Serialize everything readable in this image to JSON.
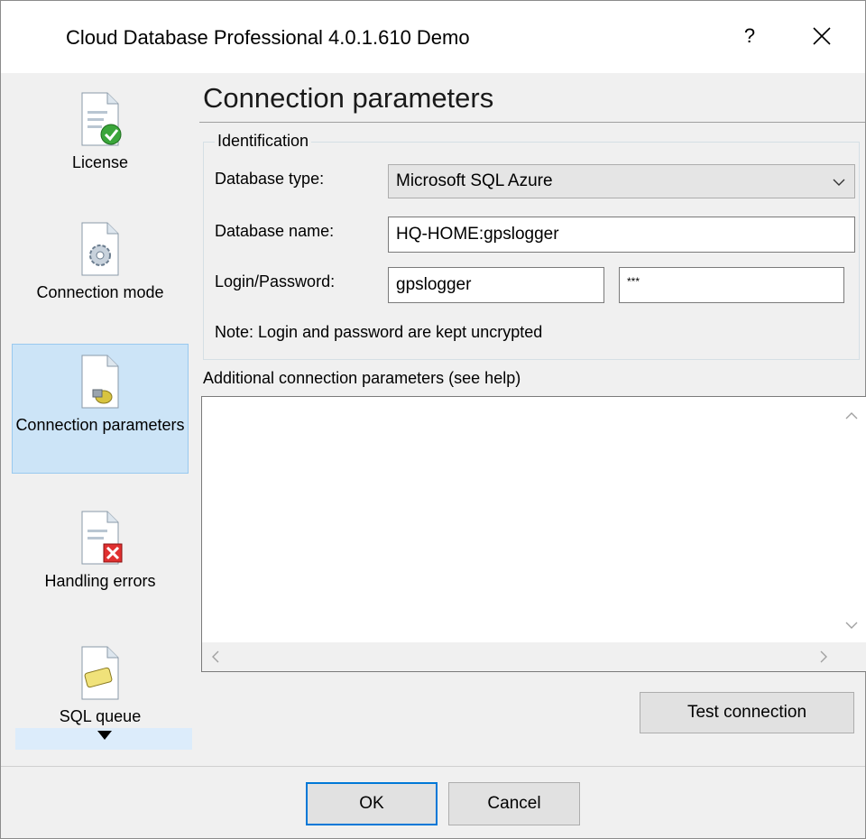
{
  "window": {
    "title": "Cloud Database Professional 4.0.1.610 Demo",
    "help_label": "?"
  },
  "sidebar": {
    "items": [
      {
        "label": "License",
        "icon": "license-check-icon"
      },
      {
        "label": "Connection mode",
        "icon": "gear-document-icon"
      },
      {
        "label": "Connection parameters",
        "icon": "plug-document-icon",
        "selected": true
      },
      {
        "label": "Handling errors",
        "icon": "error-document-icon"
      },
      {
        "label": "SQL queue",
        "icon": "queue-document-icon"
      }
    ]
  },
  "page": {
    "heading": "Connection parameters",
    "identification": {
      "group_title": "Identification",
      "db_type_label": "Database type:",
      "db_type_value": "Microsoft SQL Azure",
      "db_name_label": "Database name:",
      "db_name_value": "HQ-HOME:gpslogger",
      "login_label": "Login/Password:",
      "login_value": "gpslogger",
      "password_value": "***",
      "note": "Note: Login and password are kept uncrypted"
    },
    "additional_label": "Additional connection parameters (see help)",
    "additional_value": "",
    "test_button": "Test connection"
  },
  "footer": {
    "ok": "OK",
    "cancel": "Cancel"
  }
}
